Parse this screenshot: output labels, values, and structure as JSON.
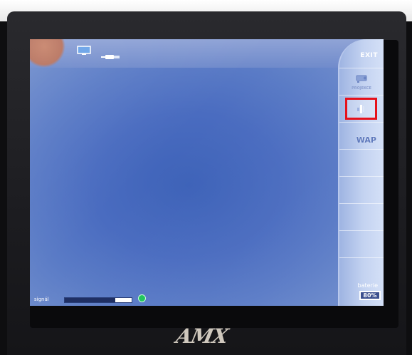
{
  "header": {
    "title": ""
  },
  "panel": {
    "exit": "EXIT",
    "projector": "PROJEKCE",
    "wap": "WAP",
    "battery_title": "baterie",
    "battery_value": "80%"
  },
  "status": {
    "signal_label": "signál",
    "signal_level": 0.75,
    "signal_ok_color": "#22c55e"
  },
  "brand": {
    "logo": "AMX"
  },
  "icons": {
    "monitor": "monitor-icon",
    "plug": "plug-icon",
    "projector": "projector-icon",
    "volume": "volume-icon"
  }
}
